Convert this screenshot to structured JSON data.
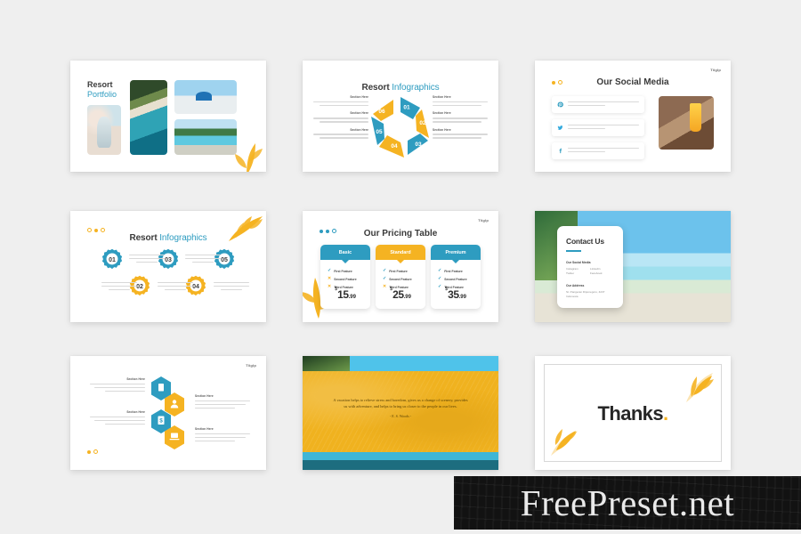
{
  "page": {
    "background_color": "#efefef",
    "watermark": "FreePreset.net"
  },
  "theme": {
    "teal": "#2e9cc0",
    "orange": "#f5b322",
    "dark_text": "#3a3a3a",
    "muted_text": "#8e8e8e"
  },
  "slides": [
    {
      "id": "portfolio",
      "title_line1": "Resort",
      "title_line2": "Portfolio",
      "photos": [
        "woman-on-beach-photo",
        "aerial-coastline-photo",
        "santorini-domes-photo",
        "resort-pool-photo"
      ],
      "decor": "wheat-leaf-ornament"
    },
    {
      "id": "hexagon-cycle",
      "title_main": "Resort",
      "title_accent": "Infographics",
      "segments": [
        {
          "number": "01",
          "color": "#2e9cc0"
        },
        {
          "number": "02",
          "color": "#f5b322"
        },
        {
          "number": "03",
          "color": "#2e9cc0"
        },
        {
          "number": "04",
          "color": "#f5b322"
        },
        {
          "number": "05",
          "color": "#2e9cc0"
        },
        {
          "number": "06",
          "color": "#f5b322"
        }
      ],
      "callouts_left": [
        {
          "heading": "Section Here",
          "body": "Lorem ipsum dolor sit amet, consectetur adipiscing elit, sed do eiusmod tempor"
        },
        {
          "heading": "Section Here",
          "body": "Lorem ipsum dolor sit amet, consectetur adipiscing elit, sed do eiusmod tempor"
        },
        {
          "heading": "Section Here",
          "body": "Lorem ipsum dolor sit amet, consectetur adipiscing elit, sed do eiusmod tempor"
        }
      ],
      "callouts_right": [
        {
          "heading": "Section Here",
          "body": "Lorem ipsum dolor sit amet, consectetur adipiscing elit, sed do eiusmod tempor"
        },
        {
          "heading": "Section Here",
          "body": "Lorem ipsum dolor sit amet, consectetur adipiscing elit, sed do eiusmod tempor"
        },
        {
          "heading": "Section Here",
          "body": "Lorem ipsum dolor sit amet, consectetur adipiscing elit, sed do eiusmod tempor"
        }
      ]
    },
    {
      "id": "social-media",
      "title": "Our Social Media",
      "corner_logo": "Tiiglp",
      "rows": [
        {
          "icon": "pinterest-icon",
          "color": "#2e9cc0",
          "body": "Lorem ipsum dolor sit amet, consectetur adipiscing elit, sed do eiusmod tempor"
        },
        {
          "icon": "twitter-icon",
          "color": "#2e9cc0",
          "body": "Lorem ipsum dolor sit amet, consectetur adipiscing elit, sed do eiusmod tempor"
        },
        {
          "icon": "facebook-icon",
          "color": "#2e9cc0",
          "body": "Lorem ipsum dolor sit amet, consectetur adipiscing elit, sed do eiusmod tempor"
        }
      ],
      "photo": "hat-juice-camera-photo"
    },
    {
      "id": "gears",
      "title_main": "Resort",
      "title_accent": "Infographics",
      "gears": [
        {
          "number": "01",
          "color": "#2e9cc0"
        },
        {
          "number": "02",
          "color": "#f5b322"
        },
        {
          "number": "03",
          "color": "#2e9cc0"
        },
        {
          "number": "04",
          "color": "#f5b322"
        },
        {
          "number": "05",
          "color": "#2e9cc0"
        }
      ],
      "captions": [
        "Ut enim ad minim veniam quis nostrud exercitation",
        "Ut enim ad minim veniam quis nostrud exercitation",
        "Ut enim ad minim veniam quis nostrud exercitation",
        "Ut enim ad minim veniam quis nostrud exercitation",
        "Ut enim ad minim veniam quis nostrud exercitation"
      ],
      "decor": "wheat-leaf-ornament"
    },
    {
      "id": "pricing",
      "title": "Our Pricing Table",
      "corner_logo": "Tiiglp",
      "plans": [
        {
          "name": "Basic",
          "header_color": "#2e9cc0",
          "currency": "$",
          "integer": "15",
          "decimal": ".99",
          "features": [
            {
              "label": "First Feature",
              "state": "included"
            },
            {
              "label": "Second Feature",
              "state": "excluded"
            },
            {
              "label": "Third Feature",
              "state": "excluded"
            }
          ]
        },
        {
          "name": "Standard",
          "header_color": "#f5b322",
          "currency": "$",
          "integer": "25",
          "decimal": ".99",
          "features": [
            {
              "label": "First Feature",
              "state": "included"
            },
            {
              "label": "Second Feature",
              "state": "included"
            },
            {
              "label": "Third Feature",
              "state": "excluded"
            }
          ]
        },
        {
          "name": "Premium",
          "header_color": "#2e9cc0",
          "currency": "$",
          "integer": "35",
          "decimal": ".99",
          "features": [
            {
              "label": "First Feature",
              "state": "included"
            },
            {
              "label": "Second Feature",
              "state": "included"
            },
            {
              "label": "Third Feature",
              "state": "included"
            }
          ]
        }
      ],
      "decor": "wheat-leaf-ornament"
    },
    {
      "id": "contact",
      "title": "Contact Us",
      "social_heading": "Our Social Media",
      "social_links": [
        "Instagram",
        "Linkedin",
        "Twitter",
        "Facebook"
      ],
      "address_heading": "Our Address",
      "address_lines": [
        "St. Pangeran Diponegoro, 4237",
        "Indonesia"
      ],
      "background": "tropical-beach-photo"
    },
    {
      "id": "hex-icons",
      "corner_logo": "Tiiglp",
      "items": [
        {
          "icon": "document-icon",
          "color": "#2e9cc0",
          "heading": "Section Here",
          "body": "Lorem ipsum dolor sit amet, consectetur adipiscing elit, sed do eiusmod tempor incididunt ut labore et dolore magna aliqua"
        },
        {
          "icon": "user-icon",
          "color": "#f5b322",
          "heading": "Section Here",
          "body": "Lorem ipsum dolor sit amet, consectetur adipiscing elit, sed do eiusmod tempor incididunt ut labore et dolore magna aliqua"
        },
        {
          "icon": "money-icon",
          "color": "#2e9cc0",
          "heading": "Section Here",
          "body": "Lorem ipsum dolor sit amet, consectetur adipiscing elit, sed do eiusmod tempor incididunt ut labore et dolore magna aliqua"
        },
        {
          "icon": "laptop-icon",
          "color": "#f5b322",
          "heading": "Section Here",
          "body": "Lorem ipsum dolor sit amet, consectetur adipiscing elit, sed do eiusmod tempor incididunt ut labore et dolore magna aliqua"
        }
      ]
    },
    {
      "id": "quote",
      "quote": "A vacation helps to relieve stress and boredom, gives us a change of scenery, provides us with adventure, and helps to bring us closer to the people in our lives.",
      "author": "- E. S. Woods -"
    },
    {
      "id": "thanks",
      "word": "Thanks",
      "period": ".",
      "decor": "wheat-leaf-ornament"
    }
  ]
}
